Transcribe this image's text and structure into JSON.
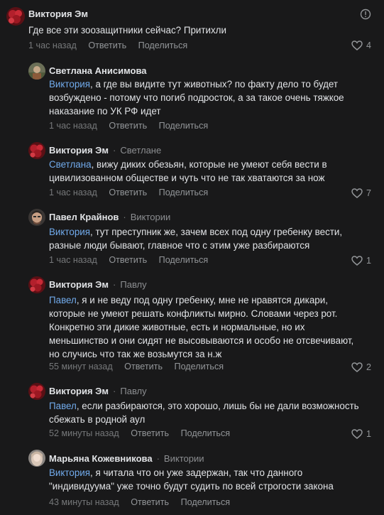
{
  "actions": {
    "reply": "Ответить",
    "share": "Поделиться"
  },
  "comments": [
    {
      "author": "Виктория Эм",
      "reply_to": "",
      "mention": "",
      "text": "Где все эти зоозащитники сейчас? Притихли",
      "time": "1 час назад",
      "likes": "4",
      "avatar": "flower-avatar"
    },
    {
      "author": "Светлана Анисимова",
      "reply_to": "",
      "mention": "Виктория",
      "text": ", а где вы видите тут животных? по факту дело то будет возбуждено - потому что погиб подросток, а за такое очень тяжкое наказание по УК РФ идет",
      "time": "1 час назад",
      "likes": "",
      "avatar": "photo-avatar"
    },
    {
      "author": "Виктория Эм",
      "reply_to": "Светлане",
      "mention": "Светлана",
      "text": ", вижу диких обезьян, которые не умеют себя вести в цивилизованном обществе и чуть что не так хватаются за нож",
      "time": "1 час назад",
      "likes": "7",
      "avatar": "flower-avatar"
    },
    {
      "author": "Павел Крайнов",
      "reply_to": "Виктории",
      "mention": "Виктория",
      "text": ", тут преступник же, зачем всех под одну гребенку вести, разные люди бывают, главное что с этим уже разбираются",
      "time": "1 час назад",
      "likes": "1",
      "avatar": "man-avatar"
    },
    {
      "author": "Виктория Эм",
      "reply_to": "Павлу",
      "mention": "Павел",
      "text": ", я и не веду под одну гребенку, мне не нравятся дикари, которые не умеют решать конфликты мирно. Словами через рот. Конкретно эти дикие животные, есть и нормальные, но их меньшинство и они сидят не высовываются и особо не отсвечивают, но случись что так же возьмутся за н.ж",
      "time": "55 минут назад",
      "likes": "2",
      "avatar": "flower-avatar"
    },
    {
      "author": "Виктория Эм",
      "reply_to": "Павлу",
      "mention": "Павел",
      "text": ", если разбираются, это хорошо, лишь бы не дали возможность сбежать в родной аул",
      "time": "52 минуты назад",
      "likes": "1",
      "avatar": "flower-avatar"
    },
    {
      "author": "Марьяна Кожевникова",
      "reply_to": "Виктории",
      "mention": "Виктория",
      "text": ", я читала что он уже задержан, так что данного \"индивидуума\" уже точно будут судить по всей строгости закона",
      "time": "43 минуты назад",
      "likes": "",
      "avatar": "woman-avatar"
    }
  ]
}
